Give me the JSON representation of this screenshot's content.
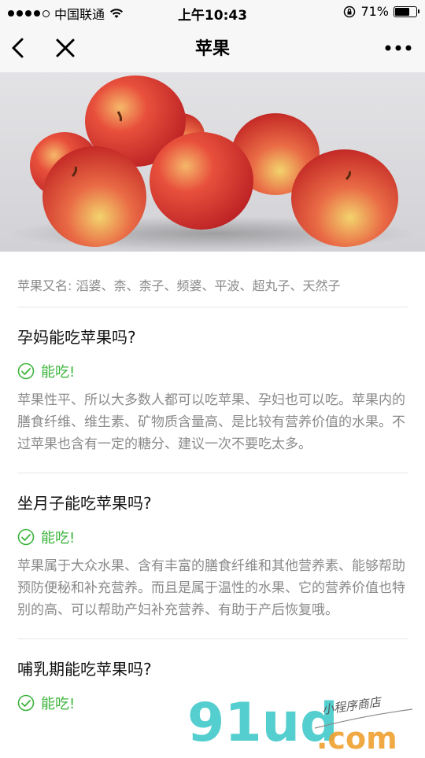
{
  "status_bar": {
    "carrier": "中国联通",
    "time": "上午10:43",
    "battery_percent": "71%",
    "battery_level": 0.71,
    "signal_bars": 4
  },
  "nav": {
    "title": "苹果",
    "icons": [
      "back-icon",
      "close-icon",
      "more-icon"
    ]
  },
  "alias_line": "苹果又名: 滔婆、柰、柰子、频婆、平波、超丸子、天然子",
  "sections": [
    {
      "question": "孕妈能吃苹果吗?",
      "verdict": "能吃!",
      "description": "苹果性平、所以大多数人都可以吃苹果、孕妇也可以吃。苹果内的膳食纤维、维生素、矿物质含量高、是比较有营养价值的水果。不过苹果也含有一定的糖分、建议一次不要吃太多。"
    },
    {
      "question": "坐月子能吃苹果吗?",
      "verdict": "能吃!",
      "description": "苹果属于大众水果、含有丰富的膳食纤维和其他营养素、能够帮助预防便秘和补充营养。而且是属于温性的水果、它的营养价值也特别的高、可以帮助产妇补充营养、有助于产后恢复哦。"
    },
    {
      "question": "哺乳期能吃苹果吗?",
      "verdict": "能吃!",
      "description": ""
    }
  ],
  "watermark": {
    "main": "91ud",
    "domain": ".com",
    "tagline": "小程序商店"
  },
  "colors": {
    "verdict_green": "#3cb43c",
    "muted_text": "#8a8a8a",
    "nav_bg": "#f7f7f7"
  }
}
